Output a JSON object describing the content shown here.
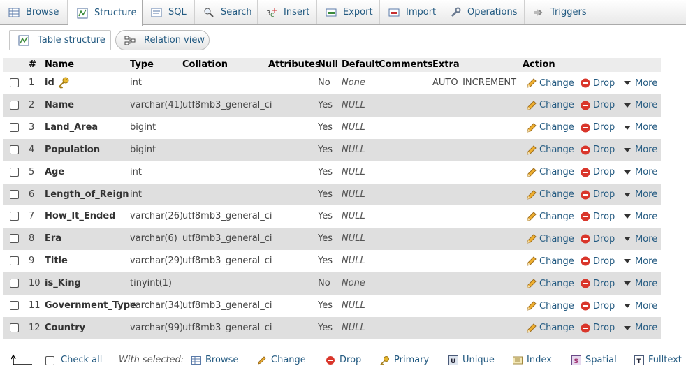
{
  "tabs": [
    {
      "label": "Browse",
      "icon": "browse-icon"
    },
    {
      "label": "Structure",
      "icon": "structure-icon",
      "active": true
    },
    {
      "label": "SQL",
      "icon": "sql-icon"
    },
    {
      "label": "Search",
      "icon": "search-icon"
    },
    {
      "label": "Insert",
      "icon": "insert-icon"
    },
    {
      "label": "Export",
      "icon": "export-icon"
    },
    {
      "label": "Import",
      "icon": "import-icon"
    },
    {
      "label": "Operations",
      "icon": "operations-icon"
    },
    {
      "label": "Triggers",
      "icon": "triggers-icon"
    }
  ],
  "subnav": [
    {
      "label": "Table structure",
      "icon": "table-structure-icon",
      "active": true
    },
    {
      "label": "Relation view",
      "icon": "relation-view-icon"
    }
  ],
  "table": {
    "headers": {
      "num": "#",
      "name": "Name",
      "type": "Type",
      "collation": "Collation",
      "attributes": "Attributes",
      "null": "Null",
      "default": "Default",
      "comments": "Comments",
      "extra": "Extra",
      "action": "Action"
    },
    "rows": [
      {
        "num": "1",
        "name": "id",
        "type": "int",
        "collation": "",
        "null": "No",
        "default": "None",
        "extra": "AUTO_INCREMENT",
        "primary_key": true
      },
      {
        "num": "2",
        "name": "Name",
        "type": "varchar(41)",
        "collation": "utf8mb3_general_ci",
        "null": "Yes",
        "default": "NULL",
        "extra": ""
      },
      {
        "num": "3",
        "name": "Land_Area",
        "type": "bigint",
        "collation": "",
        "null": "Yes",
        "default": "NULL",
        "extra": ""
      },
      {
        "num": "4",
        "name": "Population",
        "type": "bigint",
        "collation": "",
        "null": "Yes",
        "default": "NULL",
        "extra": ""
      },
      {
        "num": "5",
        "name": "Age",
        "type": "int",
        "collation": "",
        "null": "Yes",
        "default": "NULL",
        "extra": ""
      },
      {
        "num": "6",
        "name": "Length_of_Reign",
        "type": "int",
        "collation": "",
        "null": "Yes",
        "default": "NULL",
        "extra": ""
      },
      {
        "num": "7",
        "name": "How_It_Ended",
        "type": "varchar(26)",
        "collation": "utf8mb3_general_ci",
        "null": "Yes",
        "default": "NULL",
        "extra": ""
      },
      {
        "num": "8",
        "name": "Era",
        "type": "varchar(6)",
        "collation": "utf8mb3_general_ci",
        "null": "Yes",
        "default": "NULL",
        "extra": ""
      },
      {
        "num": "9",
        "name": "Title",
        "type": "varchar(29)",
        "collation": "utf8mb3_general_ci",
        "null": "Yes",
        "default": "NULL",
        "extra": ""
      },
      {
        "num": "10",
        "name": "is_King",
        "type": "tinyint(1)",
        "collation": "",
        "null": "No",
        "default": "None",
        "extra": ""
      },
      {
        "num": "11",
        "name": "Government_Type",
        "type": "varchar(34)",
        "collation": "utf8mb3_general_ci",
        "null": "Yes",
        "default": "NULL",
        "extra": ""
      },
      {
        "num": "12",
        "name": "Country",
        "type": "varchar(99)",
        "collation": "utf8mb3_general_ci",
        "null": "Yes",
        "default": "NULL",
        "extra": ""
      }
    ],
    "row_actions": {
      "change": "Change",
      "drop": "Drop",
      "more": "More"
    }
  },
  "footer": {
    "check_all": "Check all",
    "with_selected": "With selected:",
    "actions": [
      {
        "label": "Browse",
        "icon": "browse-icon"
      },
      {
        "label": "Change",
        "icon": "pencil-icon"
      },
      {
        "label": "Drop",
        "icon": "drop-icon"
      },
      {
        "label": "Primary",
        "icon": "key-icon"
      },
      {
        "label": "Unique",
        "icon": "unique-icon"
      },
      {
        "label": "Index",
        "icon": "index-icon"
      },
      {
        "label": "Spatial",
        "icon": "spatial-icon"
      },
      {
        "label": "Fulltext",
        "icon": "fulltext-icon"
      }
    ]
  },
  "colors": {
    "link": "#235a81",
    "row_alt": "#dfdfdf",
    "header_bg": "#ececec",
    "drop_red": "#d9362b"
  }
}
